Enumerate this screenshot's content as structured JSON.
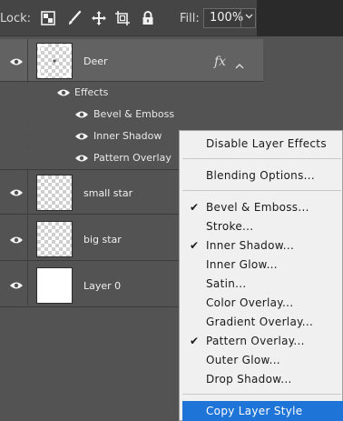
{
  "toolbar": {
    "lock_label": "Lock:",
    "fill_label": "Fill:",
    "fill_value": "100%",
    "icons": [
      "lock-transparent-pixels-icon",
      "lock-image-pixels-icon",
      "lock-position-icon",
      "lock-artboard-icon",
      "lock-all-icon"
    ]
  },
  "layers": [
    {
      "name": "Deer",
      "selected": true,
      "has_effects": true,
      "fx_label": "fx"
    },
    {
      "name": "small star",
      "selected": false
    },
    {
      "name": "big star",
      "selected": false
    },
    {
      "name": "Layer 0",
      "selected": false
    }
  ],
  "effects": {
    "header": "Effects",
    "items": [
      "Bevel & Emboss",
      "Inner Shadow",
      "Pattern Overlay"
    ]
  },
  "context_menu": {
    "items": [
      {
        "label": "Disable Layer Effects",
        "checked": false
      },
      {
        "label": "Blending Options...",
        "checked": false
      },
      {
        "label": "Bevel & Emboss...",
        "checked": true
      },
      {
        "label": "Stroke...",
        "checked": false
      },
      {
        "label": "Inner Shadow...",
        "checked": true
      },
      {
        "label": "Inner Glow...",
        "checked": false
      },
      {
        "label": "Satin...",
        "checked": false
      },
      {
        "label": "Color Overlay...",
        "checked": false
      },
      {
        "label": "Gradient Overlay...",
        "checked": false
      },
      {
        "label": "Pattern Overlay...",
        "checked": true
      },
      {
        "label": "Outer Glow...",
        "checked": false
      },
      {
        "label": "Drop Shadow...",
        "checked": false
      },
      {
        "label": "Copy Layer Style",
        "checked": false,
        "highlighted": true
      }
    ],
    "check_glyph": "✔"
  },
  "colors": {
    "panel_bg": "#535353",
    "selected_row": "#626262",
    "menu_bg": "#f0f0f0",
    "menu_highlight": "#1f74d7"
  }
}
